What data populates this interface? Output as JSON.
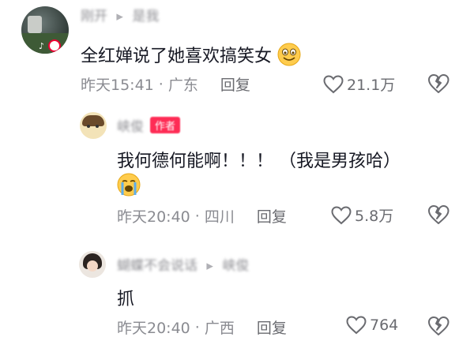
{
  "comments": [
    {
      "username": "刚开",
      "reply_to": "是我",
      "text": "全红婵说了她喜欢搞笑女",
      "emoji": "grinning-face-emoji",
      "time": "昨天15:41",
      "location": "广东",
      "reply_label": "回复",
      "likes": "21.1万"
    },
    {
      "username": "峡俊",
      "badge": "作者",
      "text": "我何德何能啊！！！  （我是男孩哈）",
      "emoji": "loudly-crying-face-emoji",
      "time": "昨天20:40",
      "location": "四川",
      "reply_label": "回复",
      "likes": "5.8万"
    },
    {
      "username": "蝴蝶不会说话",
      "reply_to": "峡俊",
      "text": "抓",
      "time": "昨天20:40",
      "location": "广西",
      "reply_label": "回复",
      "likes": "764"
    }
  ],
  "colors": {
    "text": "#161823",
    "meta": "#8a8b91",
    "badge": "#fe2c55"
  }
}
